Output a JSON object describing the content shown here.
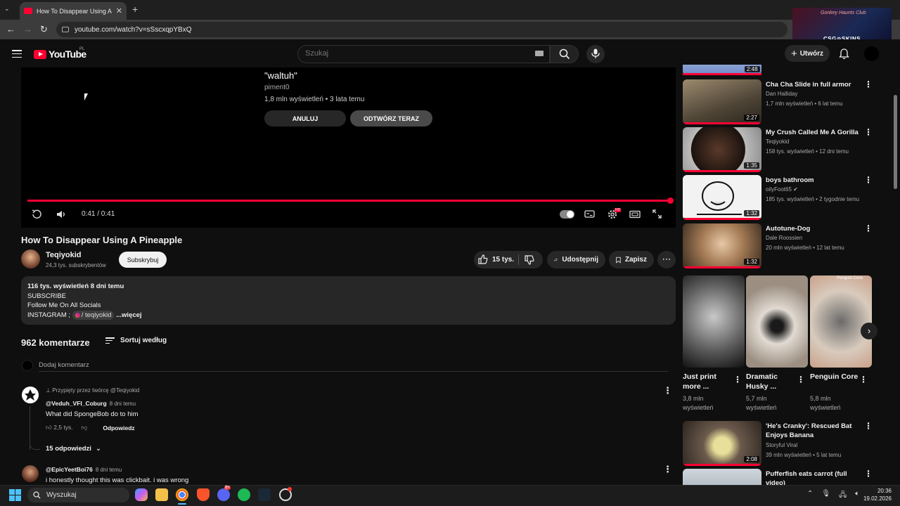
{
  "browser": {
    "tab_title": "How To Disappear Using A Pineapple",
    "url": "youtube.com/watch?v=sSscxqpYBxQ",
    "ad_subtitle": "Gonkey Haunts Club",
    "ad_brand": "CSG⊙SKINS"
  },
  "header": {
    "logo": "YouTube",
    "country": "PL",
    "search_placeholder": "Szukaj",
    "create_label": "Utwórz"
  },
  "endscreen": {
    "next_title": "\"waltuh\"",
    "next_channel": "piment0",
    "next_meta": "1,8 mln wyświetleń • 3 lata temu",
    "cancel_label": "ANULUJ",
    "play_now_label": "ODTWÓRZ TERAZ"
  },
  "player": {
    "time": "0:41 / 0:41",
    "progress": 1.0,
    "settings_badge": "HD"
  },
  "video": {
    "title": "How To Disappear Using A Pineapple",
    "channel": "Teqiyokid",
    "subscribers": "24,3 tys. subskrybentów",
    "subscribe_label": "Subskrybuj",
    "likes": "15 tys.",
    "share_label": "Udostępnij",
    "save_label": "Zapisz"
  },
  "description": {
    "stats": "116 tys. wyświetleń  8 dni temu",
    "line1": "SUBSCRIBE",
    "line2": "Follow Me On All Socials",
    "line3_prefix": " INSTAGRAM ;",
    "ig_handle": "/ teqiyokid",
    "more": "...więcej"
  },
  "comments": {
    "count_label": "962 komentarze",
    "sort_label": "Sortuj według",
    "add_placeholder": "Dodaj komentarz",
    "items": [
      {
        "pinned": "Przypięty przez twórcę @Teqiyokid",
        "author": "@Veduh_VFI_Coburg",
        "time": "8 dni temu",
        "text": "What did SpongeBob do to him",
        "likes": "2,5 tys.",
        "reply_label": "Odpowiedz",
        "replies_label": "15 odpowiedzi"
      },
      {
        "author": "@EpicYeetBoi76",
        "time": "8 dni temu",
        "text": "i honestly thought this was clickbait. i was wrong"
      }
    ]
  },
  "recommendations": [
    {
      "title": "",
      "duration": "2:48"
    },
    {
      "title": "Cha Cha Slide in full armor",
      "channel": "Dan Halliday",
      "meta": "1,7 mln wyświetleń • 6 lat temu",
      "duration": "2:27"
    },
    {
      "title": "My Crush Called Me A Gorilla",
      "channel": "Teqiyokid",
      "meta": "158 tys. wyświetleń • 12 dni temu",
      "duration": "1:35"
    },
    {
      "title": "boys bathroom",
      "channel": "oilyFoot65",
      "meta": "185 tys. wyświetleń • 2 tygodnie temu",
      "duration": "1:32"
    },
    {
      "title": "Autotune-Dog",
      "channel": "Dale Roossien",
      "meta": "20 mln wyświetleń • 12 lat temu",
      "duration": "1:32"
    },
    {
      "title": "'He's Cranky': Rescued Bat Enjoys Banana",
      "channel": "Storyful Viral",
      "meta": "39 mln wyświetleń • 5 lat temu",
      "duration": "2:08"
    },
    {
      "title": "Pufferfish eats carrot (full video)"
    }
  ],
  "shorts": [
    {
      "title": "Just print more ...",
      "views": "3,8 mln wyświetleń"
    },
    {
      "title": "Dramatic Husky ...",
      "views": "5,7 mln wyświetleń"
    },
    {
      "title": "Penguin Core",
      "views": "5,8 mln wyświetleń",
      "overlay": "Penguin Core."
    }
  ],
  "taskbar": {
    "search_label": "Wyszukaj",
    "time": "20:36",
    "date": "19.02.2026",
    "discord_badge": "9+"
  },
  "colors": {
    "accent": "#ff0033",
    "background": "#0f0f0f",
    "surface": "#272727"
  }
}
